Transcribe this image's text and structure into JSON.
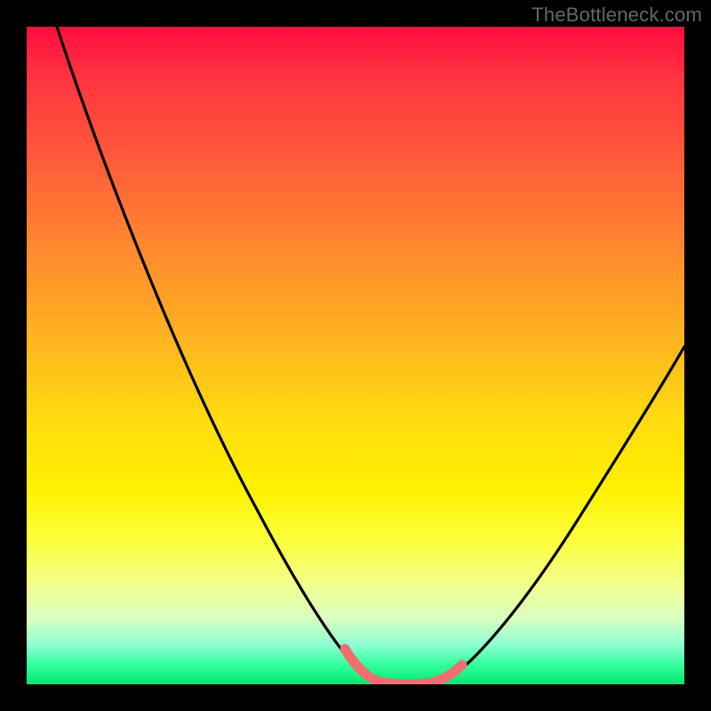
{
  "watermark": "TheBottleneck.com",
  "colors": {
    "background": "#000000",
    "curve": "#000000",
    "highlight": "#ef6e6e",
    "gradient_top": "#ff0c3f",
    "gradient_bottom": "#00e870"
  },
  "chart_data": {
    "type": "line",
    "title": "",
    "xlabel": "",
    "ylabel": "",
    "xlim": [
      0,
      100
    ],
    "ylim": [
      0,
      100
    ],
    "grid": false,
    "legend": false,
    "note": "Axes unlabeled in source image; values are percentage of plot area. y represents bottleneck magnitude (0 = no bottleneck, 100 = maximum). Curve descends steeply, flattens near x≈53–63, then rises.",
    "series": [
      {
        "name": "bottleneck-curve",
        "x": [
          5,
          10,
          15,
          20,
          25,
          30,
          35,
          40,
          45,
          49,
          51,
          53,
          55,
          58,
          61,
          63,
          65,
          68,
          72,
          78,
          85,
          92,
          100
        ],
        "y": [
          100,
          91,
          82,
          73,
          63,
          53,
          43,
          33,
          22,
          12,
          7,
          3,
          1,
          0,
          0,
          1,
          3,
          7,
          13,
          22,
          33,
          44,
          56
        ]
      }
    ],
    "highlight_range": {
      "x_start": 49,
      "x_end": 65,
      "meaning": "optimal / no-bottleneck region"
    }
  }
}
